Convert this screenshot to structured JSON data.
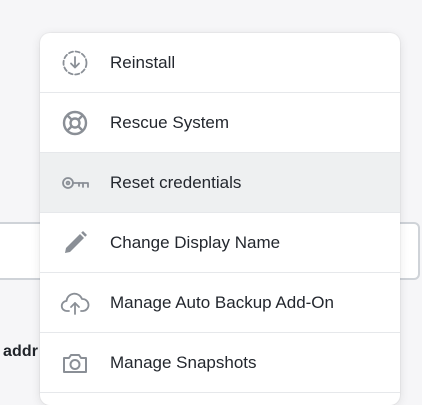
{
  "background": {
    "label_partial": "addr"
  },
  "menu": {
    "items": [
      {
        "label": "Reinstall",
        "icon": "reinstall-download-icon"
      },
      {
        "label": "Rescue System",
        "icon": "lifebuoy-icon"
      },
      {
        "label": "Reset credentials",
        "icon": "key-icon"
      },
      {
        "label": "Change Display Name",
        "icon": "pencil-icon"
      },
      {
        "label": "Manage Auto Backup Add-On",
        "icon": "cloud-upload-icon"
      },
      {
        "label": "Manage Snapshots",
        "icon": "camera-icon"
      }
    ],
    "hovered_index": 2
  },
  "colors": {
    "icon": "#8a8f96",
    "text": "#23272e",
    "hover": "#eef0f1",
    "divider": "#e6e8eb"
  }
}
